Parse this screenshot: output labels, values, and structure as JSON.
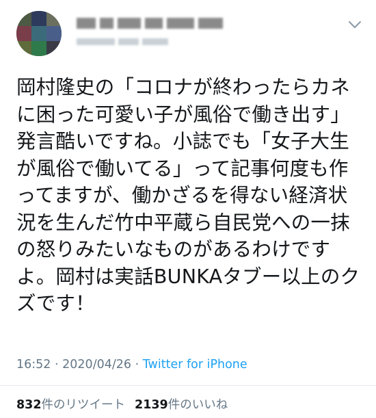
{
  "tweet": {
    "text_lines": [
      "岡村隆史の「コロナが終わったらカネ",
      "に困った可愛い子が風俗で働き出す」",
      "発言酷いですね。小誌でも「女子大生",
      "が風俗で働いてる」って記事何度も作",
      "ってますが、働かざるを得ない経済状",
      "況を生んだ竹中平蔵ら自民党への一抹",
      "の怒りみたいなものがあるわけです",
      "よ。岡村は実話BUNKAタブー以上のク",
      "ズです！"
    ],
    "time": "16:52",
    "separator": "·",
    "date": "2020/04/26",
    "source": "Twitter for iPhone",
    "retweet_count": "832",
    "retweet_label": "件のリツイート",
    "like_count": "2139",
    "like_label": "件のいいね"
  },
  "icons": {
    "menu": "chevron-down-icon",
    "avatar": "avatar"
  },
  "colors": {
    "text": "#14171a",
    "secondary": "#657786",
    "link": "#1da1f2",
    "divider": "#e1e8ed"
  }
}
